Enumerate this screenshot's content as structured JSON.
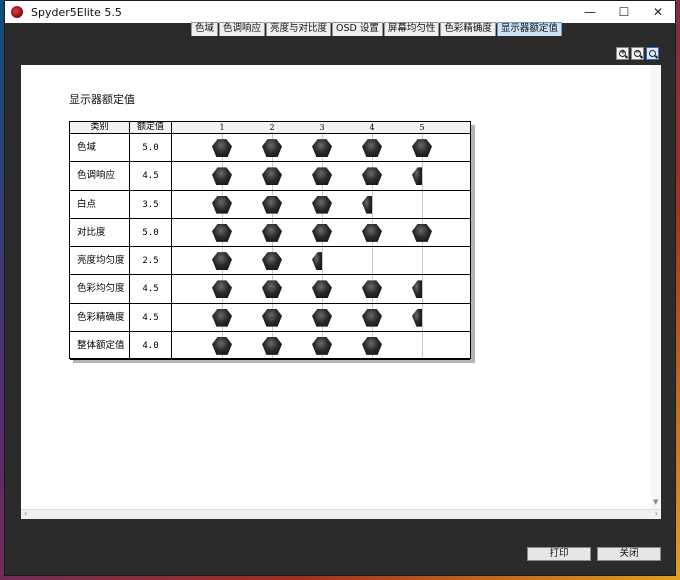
{
  "window": {
    "title": "Spyder5Elite 5.5",
    "controls": [
      "—",
      "☐",
      "✕"
    ]
  },
  "tabs": [
    {
      "label": "色域",
      "active": false
    },
    {
      "label": "色调响应",
      "active": false
    },
    {
      "label": "亮度与对比度",
      "active": false
    },
    {
      "label": "OSD 设置",
      "active": false
    },
    {
      "label": "屏幕均匀性",
      "active": false
    },
    {
      "label": "色彩精确度",
      "active": false
    },
    {
      "label": "显示器额定值",
      "active": true
    }
  ],
  "zoom": [
    {
      "icon": "zoom-in-icon",
      "symbol": "+"
    },
    {
      "icon": "zoom-out-icon",
      "symbol": "−"
    },
    {
      "icon": "zoom-fit-icon",
      "symbol": ""
    }
  ],
  "report": {
    "title": "显示器额定值",
    "columns": {
      "category": "类别",
      "rating": "额定值",
      "scale": [
        "1",
        "2",
        "3",
        "4",
        "5"
      ]
    },
    "rows": [
      {
        "category": "色域",
        "rating": "5.0"
      },
      {
        "category": "色调响应",
        "rating": "4.5"
      },
      {
        "category": "白点",
        "rating": "3.5"
      },
      {
        "category": "对比度",
        "rating": "5.0"
      },
      {
        "category": "亮度均匀度",
        "rating": "2.5"
      },
      {
        "category": "色彩均匀度",
        "rating": "4.5"
      },
      {
        "category": "色彩精确度",
        "rating": "4.5"
      },
      {
        "category": "整体额定值",
        "rating": "4.0"
      }
    ]
  },
  "chart_data": {
    "type": "table",
    "categories": [
      "色域",
      "色调响应",
      "白点",
      "对比度",
      "亮度均匀度",
      "色彩均匀度",
      "色彩精确度",
      "整体额定值"
    ],
    "values": [
      5.0,
      4.5,
      3.5,
      5.0,
      2.5,
      4.5,
      4.5,
      4.0
    ],
    "xlim": [
      1,
      5
    ],
    "gridlines": true
  },
  "buttons": {
    "print": "打印",
    "close": "关闭"
  }
}
